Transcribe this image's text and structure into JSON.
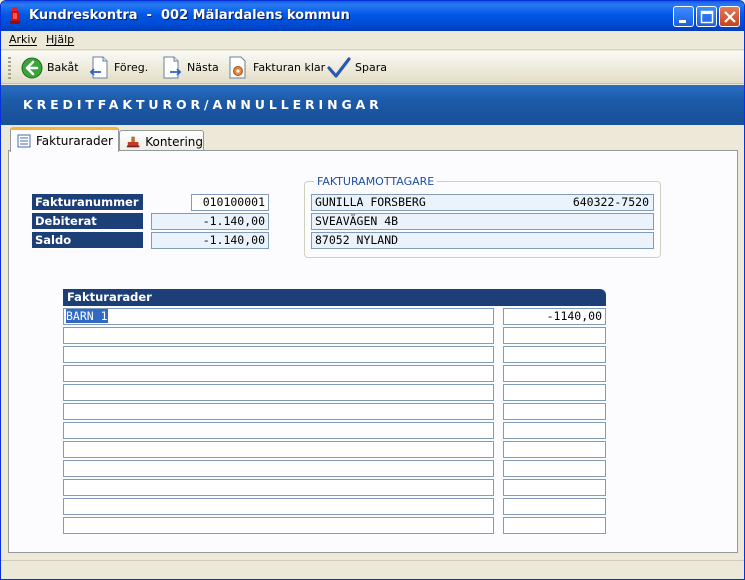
{
  "window": {
    "title": "Kundreskontra  -  002 Mälardalens kommun",
    "app_icon": "app-icon",
    "controls": {
      "minimize": "minimize-icon",
      "maximize": "maximize-icon",
      "close": "close-icon"
    }
  },
  "menu": {
    "items": [
      {
        "label": "Arkiv"
      },
      {
        "label": "Hjälp"
      }
    ]
  },
  "toolbar": {
    "back_label": "Bakåt",
    "prev_label": "Föreg.",
    "next_label": "Nästa",
    "invoice_done_label": "Fakturan klar",
    "save_label": "Spara"
  },
  "header": {
    "title": "KREDITFAKTUROR/ANNULLERINGAR"
  },
  "tabs": [
    {
      "label": "Fakturarader",
      "active": true
    },
    {
      "label": "Kontering",
      "active": false
    }
  ],
  "invoice": {
    "number_label": "Fakturanummer",
    "number_value": "010100001",
    "debited_label": "Debiterat",
    "debited_value": "-1.140,00",
    "balance_label": "Saldo",
    "balance_value": "-1.140,00"
  },
  "recipient": {
    "legend": "FAKTURAMOTTAGARE",
    "name": "GUNILLA FORSBERG",
    "id_number": "640322-7520",
    "street": "SVEAVÄGEN 4B",
    "postal": "87052 NYLAND"
  },
  "rows": {
    "header": "Fakturarader",
    "items": [
      {
        "description": "BARN 1",
        "amount": "-1140,00"
      }
    ]
  },
  "colors": {
    "title_bar": "#0058e6",
    "banner": "#1c5aa8",
    "label_bg": "#1d3f77",
    "tab_accent": "#f5b43b",
    "selection": "#316ac5"
  }
}
